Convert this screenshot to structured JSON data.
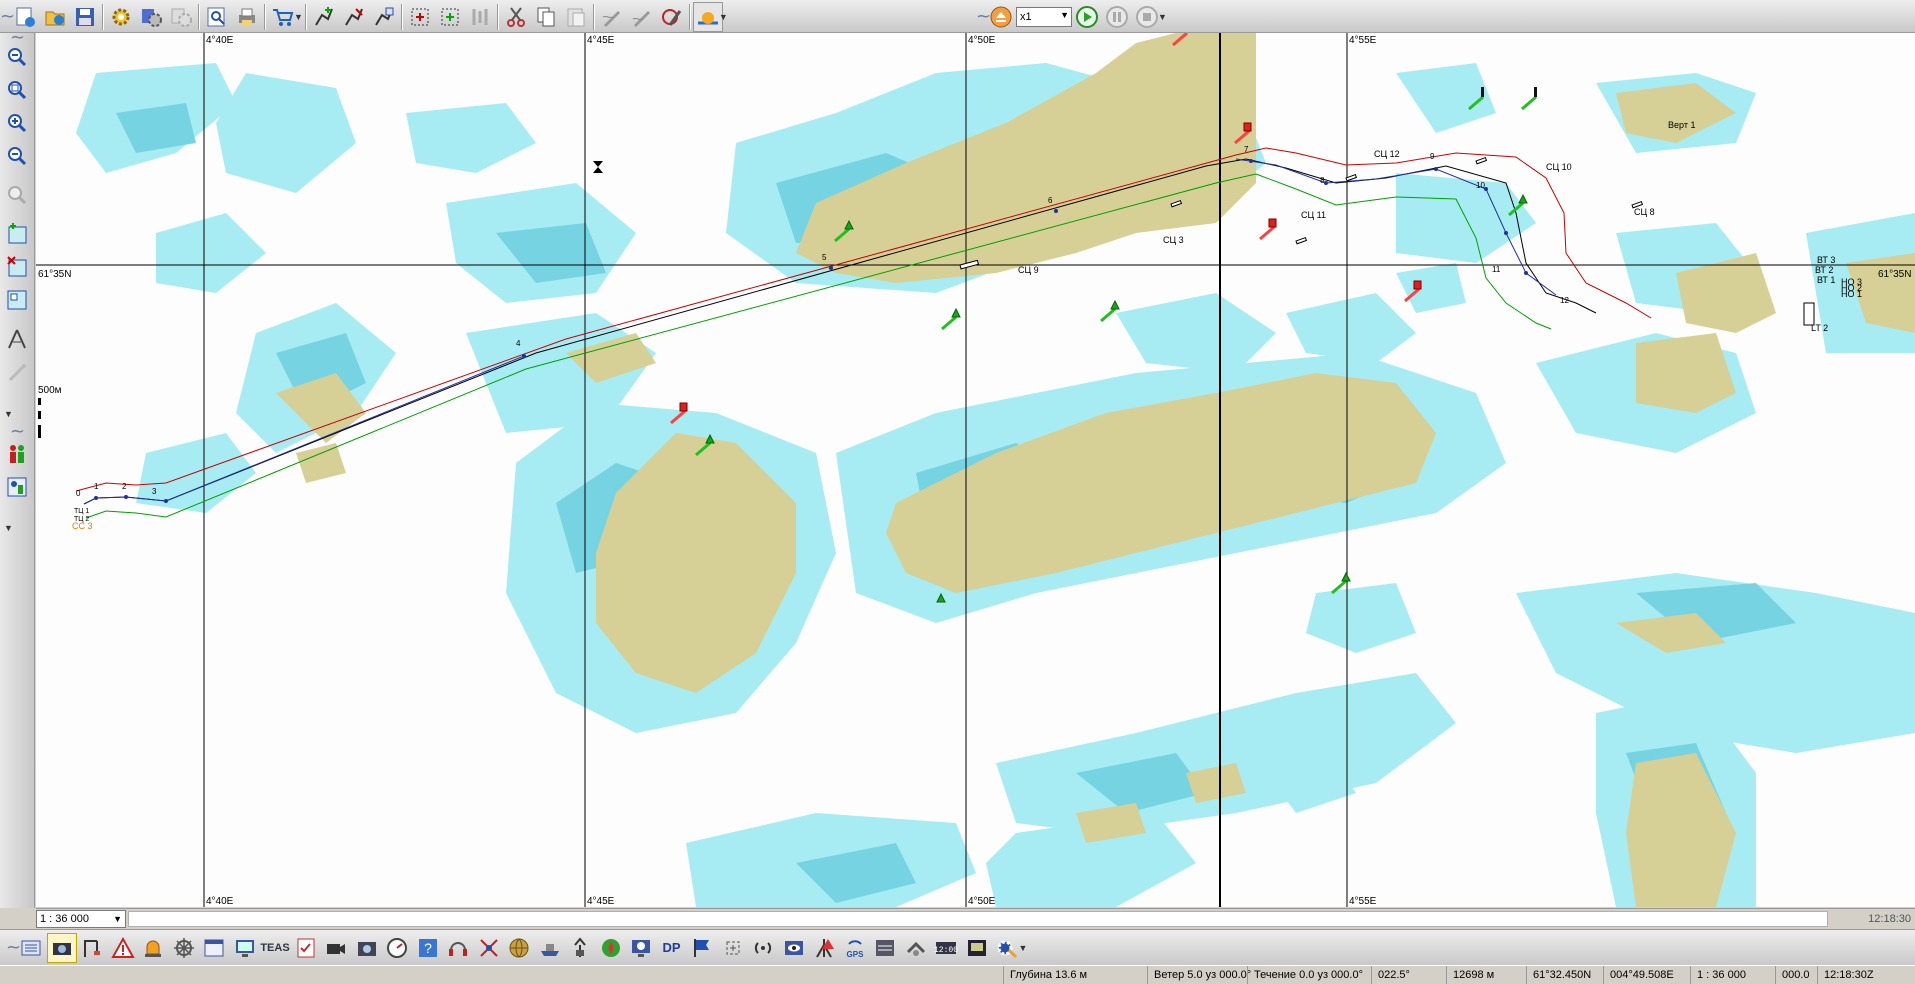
{
  "top_toolbar": {
    "zoom_factor": "x1",
    "buttons": [
      "new-file-icon",
      "open-file-icon",
      "save-file-icon",
      "settings-gear-icon",
      "settings-gear-2-icon",
      "settings-gear-3-icon",
      "find-icon",
      "print-icon",
      "shopping-cart-icon",
      "route-add-icon",
      "route-edit-icon",
      "route-copy-icon",
      "puzzle-icon",
      "puzzle-2-icon",
      "tools-icon",
      "scissors-icon",
      "copy-icon",
      "paste-icon",
      "pen-icon",
      "pen-2-icon",
      "draw-icon",
      "weather-icon",
      "eject-icon",
      "play-icon",
      "pause-icon",
      "stop-icon"
    ]
  },
  "left_toolbar": {
    "buttons": [
      "zoom-out-icon",
      "zoom-in-icon",
      "zoom-plus-icon",
      "zoom-minus-icon",
      "zoom-disabled-icon",
      "add-chart-icon",
      "remove-chart-icon",
      "chart-catalog-icon",
      "ruler-icon",
      "measure-icon",
      "more-icon",
      "people-icon",
      "people-2-icon",
      "more-2-icon"
    ]
  },
  "chart": {
    "grid_lon_labels": [
      "4°40E",
      "4°45E",
      "4°50E",
      "4°55E"
    ],
    "grid_lat_label": "61°35N",
    "depth_scale_label": "500м",
    "route_labels": [
      "0",
      "1",
      "2",
      "3",
      "4",
      "5",
      "6",
      "7",
      "8",
      "9",
      "10",
      "11",
      "12"
    ],
    "object_labels": [
      "СЦ 12",
      "СЦ 10",
      "СЦ 11",
      "СЦ 3",
      "СЦ 9",
      "СЦ 8",
      "Верт 1",
      "LT 2",
      "ВТ 3",
      "ВТ 2",
      "ВТ 1",
      "НО 3",
      "НО 2",
      "НО 1",
      "СС 3"
    ],
    "start_labels": [
      "ТЦ 1",
      "ТЦ 2"
    ],
    "colors": {
      "land": "#d6cf96",
      "shallow": "#a7ecf2",
      "deep_shallow": "#76d4e2",
      "sea": "#fdfdfd",
      "route_red": "#cc0000",
      "route_green": "#00a000",
      "route_black": "#000000",
      "route_blue": "#2030a0",
      "orange_label": "#e08000"
    }
  },
  "scale_bar": {
    "scale_value": "1 : 36 000",
    "time": "12:18:30"
  },
  "bottom_toolbar": {
    "buttons": [
      "layers-icon",
      "camera-icon",
      "crane-icon",
      "warning-icon",
      "alarm-light-icon",
      "helm-icon",
      "window-icon",
      "display-icon",
      "TEAS",
      "checklist-icon",
      "video-camera-icon",
      "photo-icon",
      "gauge-icon",
      "help-icon",
      "headset-icon",
      "radar-icon",
      "globe-icon",
      "ship-icon",
      "antenna-icon",
      "fire-icon",
      "monitor-icon",
      "DP",
      "flag-icon",
      "sync-icon",
      "signal-icon",
      "eye-icon",
      "gps-alert-icon",
      "GPS",
      "ais-icon",
      "pump-icon",
      "clock-icon",
      "camera-2-icon",
      "tools-2-icon"
    ],
    "teas_label": "TEAS",
    "dp_label": "DP",
    "gps_label": "GPS"
  },
  "status_bar": {
    "depth": "Глубина 13.6 м",
    "wind": "Ветер 5.0 уз 000.0°",
    "current": "Течение 0.0 уз 000.0°",
    "heading": "022.5°",
    "distance": "12698 м",
    "latitude": "61°32.450N",
    "longitude": "004°49.508E",
    "scale": "1 : 36 000",
    "speed": "000.0",
    "utc_time": "12:18:30Z"
  }
}
